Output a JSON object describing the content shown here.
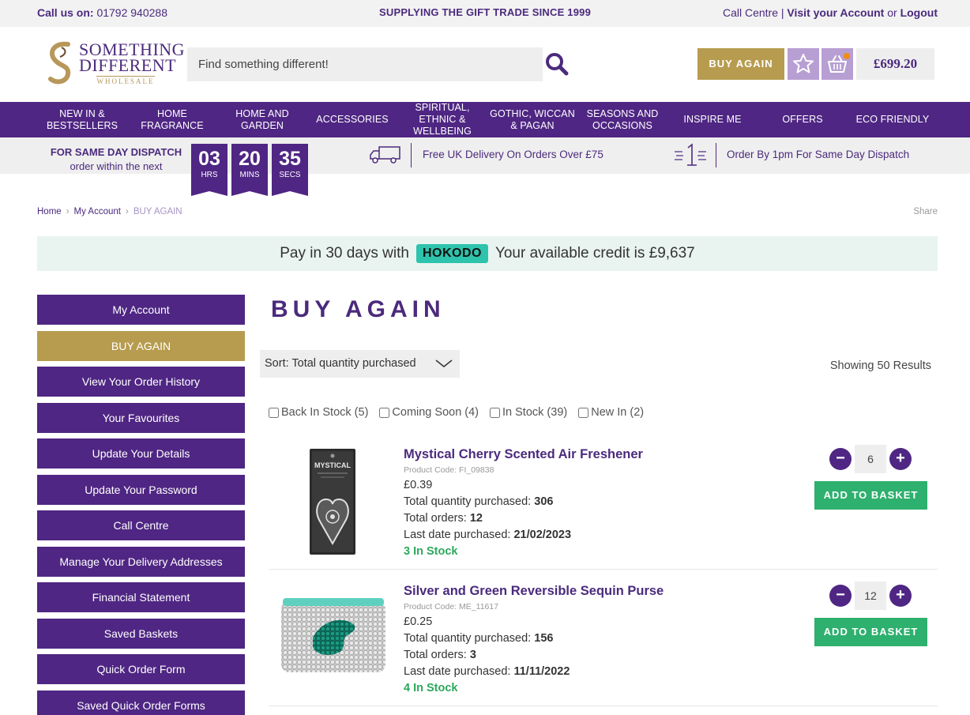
{
  "topbar": {
    "call_label": "Call us on:",
    "call_number": "01792 940288",
    "tagline": "SUPPLYING THE GIFT TRADE SINCE 1999",
    "call_centre": "Call Centre",
    "pipe": "|",
    "visit_account": "Visit your Account",
    "or": "or",
    "logout": "Logout"
  },
  "logo": {
    "line1": "SOMETHING",
    "line2": "DIFFERENT",
    "line3": "WHOLESALE"
  },
  "search": {
    "placeholder": "Find something different!"
  },
  "header": {
    "buy_again": "BUY AGAIN",
    "basket_total": "£699.20"
  },
  "nav": [
    "NEW IN & BESTSELLERS",
    "HOME FRAGRANCE",
    "HOME AND GARDEN",
    "ACCESSORIES",
    "SPIRITUAL, ETHNIC & WELLBEING",
    "GOTHIC, WICCAN & PAGAN",
    "SEASONS AND OCCASIONS",
    "INSPIRE ME",
    "OFFERS",
    "ECO FRIENDLY"
  ],
  "dispatch": {
    "title": "FOR SAME DAY DISPATCH",
    "subtitle": "order within the next",
    "hours": "03",
    "hours_label": "HRS",
    "mins": "20",
    "mins_label": "MINS",
    "secs": "35",
    "secs_label": "SECS",
    "free_delivery": "Free UK Delivery On Orders Over £75",
    "order_by": "Order By 1pm For Same Day Dispatch"
  },
  "breadcrumb": {
    "home": "Home",
    "account": "My Account",
    "current": "BUY AGAIN",
    "share": "Share"
  },
  "hokodo": {
    "text1": "Pay in 30 days with",
    "badge": "HOKODO",
    "text2": "Your available credit is £9,637"
  },
  "sidebar": [
    "My Account",
    "BUY AGAIN",
    "View Your Order History",
    "Your Favourites",
    "Update Your Details",
    "Update Your Password",
    "Call Centre",
    "Manage Your Delivery Addresses",
    "Financial Statement",
    "Saved Baskets",
    "Quick Order Form",
    "Saved Quick Order Forms"
  ],
  "main": {
    "title": "BUY AGAIN",
    "sort": "Sort: Total quantity purchased",
    "showing": "Showing 50 Results",
    "filters": [
      {
        "label": "Back In Stock (5)",
        "checked": false
      },
      {
        "label": "Coming Soon (4)",
        "checked": false
      },
      {
        "label": "In Stock (39)",
        "checked": false
      },
      {
        "label": "New In (2)",
        "checked": false
      }
    ]
  },
  "products": [
    {
      "title": "Mystical Cherry Scented Air Freshener",
      "code": "Product Code: FI_09838",
      "price": "£0.39",
      "qty_label": "Total quantity purchased:",
      "qty": "306",
      "orders_label": "Total orders:",
      "orders": "12",
      "last_label": "Last date purchased:",
      "last": "21/02/2023",
      "stock": "3 In Stock",
      "basket_qty": "6",
      "add": "ADD TO BASKET",
      "image_text": "MYSTICAL"
    },
    {
      "title": "Silver and Green Reversible Sequin Purse",
      "code": "Product Code: ME_11617",
      "price": "£0.25",
      "qty_label": "Total quantity purchased:",
      "qty": "156",
      "orders_label": "Total orders:",
      "orders": "3",
      "last_label": "Last date purchased:",
      "last": "11/11/2022",
      "stock": "4 In Stock",
      "basket_qty": "12",
      "add": "ADD TO BASKET"
    }
  ],
  "colors": {
    "purple": "#4f2683",
    "gold": "#b79c4f",
    "green": "#2eb06e",
    "lilac": "#b79fd3",
    "teal": "#2ec3ad"
  }
}
